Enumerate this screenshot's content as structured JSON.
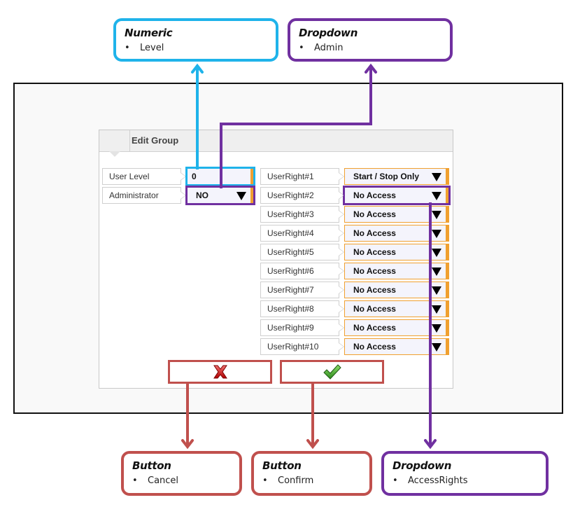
{
  "dialog": {
    "title": "Edit Group",
    "fields": [
      {
        "label": "User Level",
        "value": "0",
        "type": "numeric"
      },
      {
        "label": "Administrator",
        "value": "NO",
        "type": "dropdown"
      }
    ],
    "user_rights": [
      {
        "label": "UserRight#1",
        "value": "Start / Stop Only"
      },
      {
        "label": "UserRight#2",
        "value": "No Access"
      },
      {
        "label": "UserRight#3",
        "value": "No Access"
      },
      {
        "label": "UserRight#4",
        "value": "No Access"
      },
      {
        "label": "UserRight#5",
        "value": "No Access"
      },
      {
        "label": "UserRight#6",
        "value": "No Access"
      },
      {
        "label": "UserRight#7",
        "value": "No Access"
      },
      {
        "label": "UserRight#8",
        "value": "No Access"
      },
      {
        "label": "UserRight#9",
        "value": "No Access"
      },
      {
        "label": "UserRight#10",
        "value": "No Access"
      }
    ],
    "buttons": {
      "cancel_icon": "red-x-icon",
      "confirm_icon": "green-check-icon"
    }
  },
  "annotations": [
    {
      "id": "numeric",
      "title": "Numeric",
      "bullet": "Level",
      "color": "#1fb3ea"
    },
    {
      "id": "dropdown-admin",
      "title": "Dropdown",
      "bullet": "Admin",
      "color": "#7030a0"
    },
    {
      "id": "button-cancel",
      "title": "Button",
      "bullet": "Cancel",
      "color": "#c0504d"
    },
    {
      "id": "button-confirm",
      "title": "Button",
      "bullet": "Confirm",
      "color": "#c0504d"
    },
    {
      "id": "dropdown-access",
      "title": "Dropdown",
      "bullet": "AccessRights",
      "color": "#7030a0"
    }
  ],
  "bullet_glyph": "•"
}
